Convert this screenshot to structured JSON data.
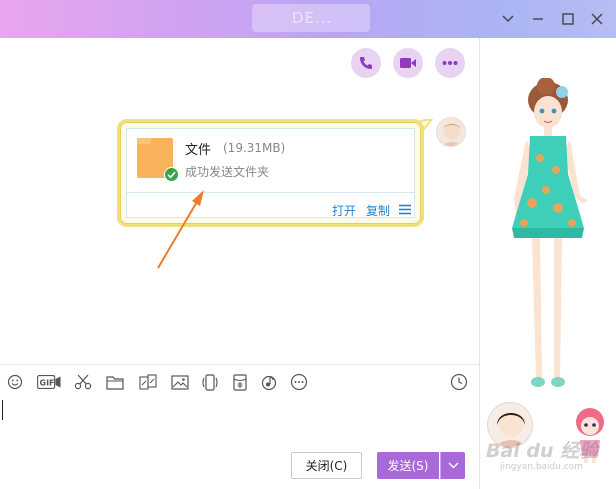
{
  "window": {
    "title": "DE...",
    "controls": {
      "minimize_icon": "chevron-down-icon",
      "restore_icon": "minimize-icon",
      "maximize_icon": "maximize-icon",
      "close_icon": "close-icon"
    }
  },
  "header_actions": [
    {
      "name": "voice-call",
      "icon": "phone-icon"
    },
    {
      "name": "video-call",
      "icon": "video-camera-icon"
    },
    {
      "name": "more",
      "icon": "more-dots-icon"
    }
  ],
  "message": {
    "file_name": "文件",
    "file_size": "(19.31MB)",
    "status": "成功发送文件夹",
    "actions": {
      "open": "打开",
      "copy": "复制"
    },
    "icons": {
      "folder": "folder-icon",
      "check": "check-circle-icon",
      "menu": "menu-icon"
    }
  },
  "toolbar": {
    "icons": [
      "emoji-icon",
      "gif-icon",
      "scissors-icon",
      "folder-icon",
      "gallery-icon",
      "image-icon",
      "shake-icon",
      "red-packet-icon",
      "music-icon",
      "more-icon",
      "history-clock-icon"
    ],
    "gif_label": "GIF"
  },
  "buttons": {
    "close": "关闭(C)",
    "send": "发送(S)"
  },
  "watermark": {
    "brand": "Bai du 经验",
    "url": "jingyan.baidu.com"
  },
  "colors": {
    "accent": "#a969d8",
    "link": "#1f86d2",
    "bubble_border": "#f1df7c",
    "check": "#3aa14d",
    "folder": "#f7b25a"
  }
}
